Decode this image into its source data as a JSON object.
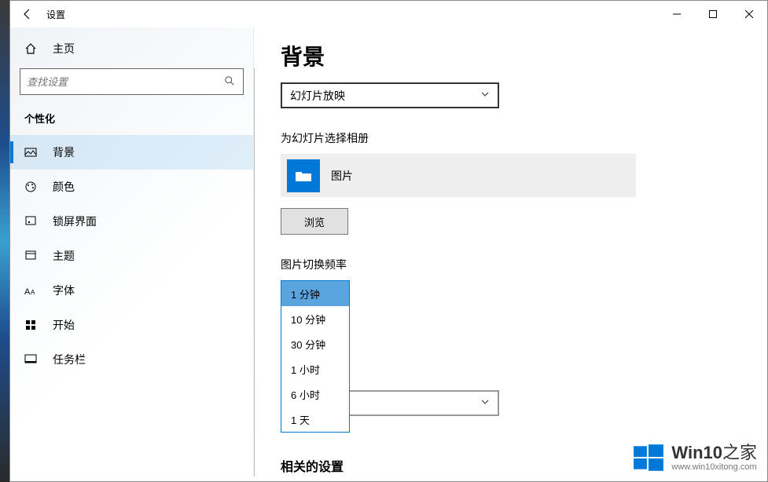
{
  "window": {
    "title": "设置"
  },
  "sidebar": {
    "home": "主页",
    "search_placeholder": "查找设置",
    "section": "个性化",
    "items": [
      {
        "label": "背景"
      },
      {
        "label": "颜色"
      },
      {
        "label": "锁屏界面"
      },
      {
        "label": "主题"
      },
      {
        "label": "字体"
      },
      {
        "label": "开始"
      },
      {
        "label": "任务栏"
      }
    ]
  },
  "content": {
    "heading": "背景",
    "bg_mode_selected": "幻灯片放映",
    "album_label": "为幻灯片选择相册",
    "album_name": "图片",
    "browse_btn": "浏览",
    "interval_label": "图片切换频率",
    "interval_options": [
      "1 分钟",
      "10 分钟",
      "30 分钟",
      "1 小时",
      "6 小时",
      "1 天"
    ],
    "related_heading": "相关的设置"
  },
  "watermark": {
    "brand": "Win10",
    "suffix": "之家",
    "url": "www.win10xitong.com"
  }
}
